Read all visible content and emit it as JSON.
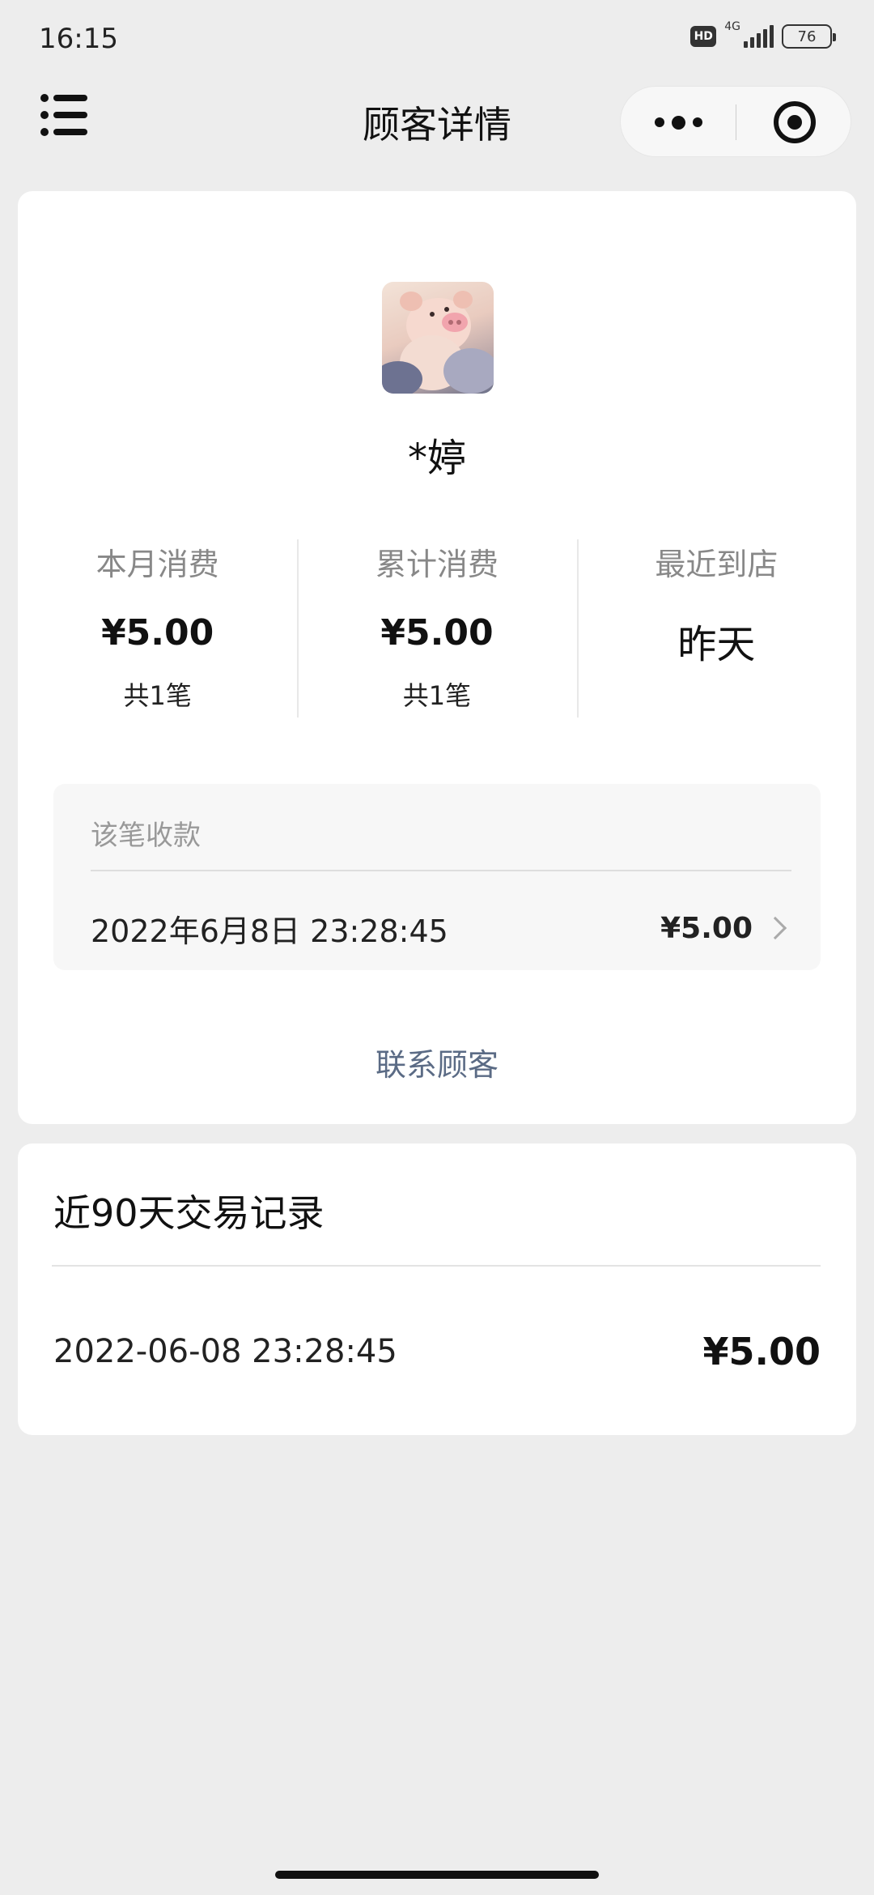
{
  "status_bar": {
    "time": "16:15",
    "hd": "HD",
    "network": "4G",
    "battery": "76"
  },
  "nav": {
    "title": "顾客详情",
    "menu_icon": "list-icon",
    "more_icon": "more-dots-icon",
    "close_icon": "target-icon"
  },
  "customer": {
    "avatar_icon": "pig-avatar",
    "name": "*婷"
  },
  "stats": [
    {
      "label": "本月消费",
      "value": "¥5.00",
      "sub": "共1笔"
    },
    {
      "label": "累计消费",
      "value": "¥5.00",
      "sub": "共1笔"
    },
    {
      "label": "最近到店",
      "value": "昨天"
    }
  ],
  "payment": {
    "header": "该笔收款",
    "time": "2022年6月8日 23:28:45",
    "amount": "¥5.00"
  },
  "contact_label": "联系顾客",
  "records": {
    "title": "近90天交易记录",
    "items": [
      {
        "time": "2022-06-08 23:28:45",
        "amount": "¥5.00"
      }
    ]
  },
  "colors": {
    "page_bg": "#ededed",
    "card_bg": "#ffffff",
    "link": "#5b6b85",
    "muted": "#888888"
  }
}
